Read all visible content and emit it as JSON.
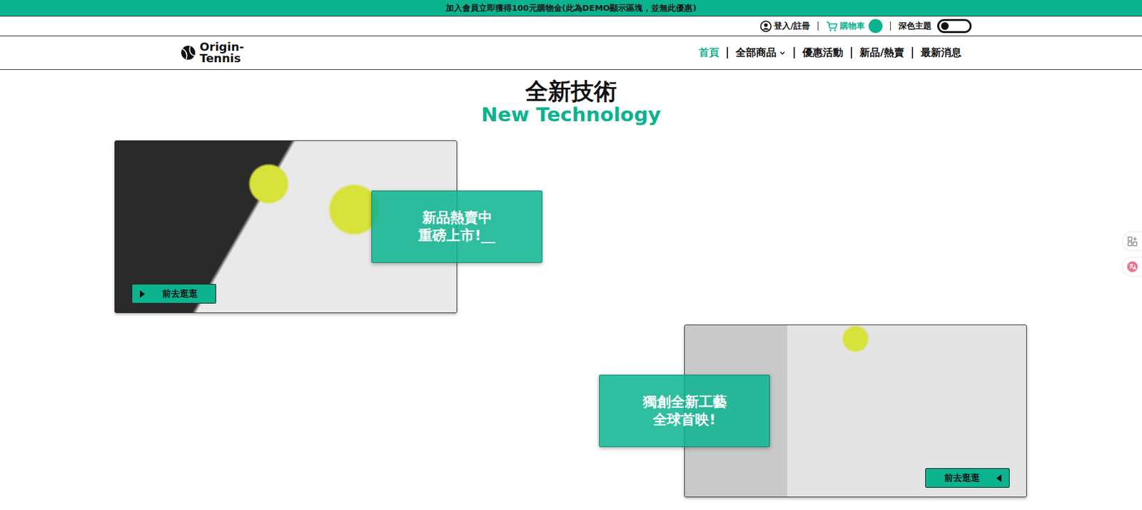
{
  "banner": {
    "text": "加入會員立即獲得100元購物金(此為DEMO顯示區塊，並無此優惠)"
  },
  "topbar": {
    "login": "登入/註冊",
    "cart": "購物車",
    "theme": {
      "label": "深色主題",
      "on": false
    }
  },
  "logo": {
    "lines": [
      "Origin-",
      "Tennis"
    ]
  },
  "nav": [
    {
      "label": "首頁",
      "selected": true,
      "dropdown": false
    },
    {
      "label": "全部商品",
      "selected": false,
      "dropdown": true
    },
    {
      "label": "優惠活動",
      "selected": false,
      "dropdown": false
    },
    {
      "label": "新品/熱賣",
      "selected": false,
      "dropdown": false
    },
    {
      "label": "最新消息",
      "selected": false,
      "dropdown": false
    }
  ],
  "section": {
    "title": "全新技術",
    "subtitle": "New Technology"
  },
  "cards": [
    {
      "kind": "left",
      "caption": [
        "新品熱賣中",
        "重磅上市!__"
      ],
      "button": "前去逛逛"
    },
    {
      "kind": "right",
      "caption": [
        "獨創全新工藝",
        "全球首映!"
      ],
      "button": "前去逛逛"
    }
  ]
}
